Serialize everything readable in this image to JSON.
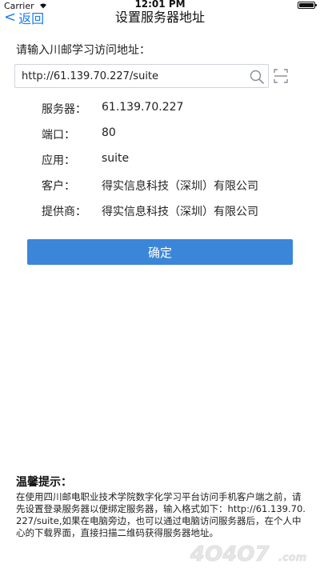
{
  "status_bar": {
    "carrier": "Carrier",
    "time": "12:01 PM"
  },
  "nav": {
    "back_label": "返回",
    "title": "设置服务器地址"
  },
  "form": {
    "prompt": "请输入川邮学习访问地址：",
    "url_value": "http://61.139.70.227/suite"
  },
  "info": [
    {
      "label": "服务器：",
      "value": "61.139.70.227"
    },
    {
      "label": "端口：",
      "value": "80"
    },
    {
      "label": "应用：",
      "value": "suite"
    },
    {
      "label": "客户：",
      "value": "得实信息科技（深圳）有限公司"
    },
    {
      "label": "提供商：",
      "value": "得实信息科技（深圳）有限公司"
    }
  ],
  "confirm_label": "确定",
  "tips": {
    "title": "温馨提示：",
    "body": "在使用四川邮电职业技术学院数字化学习平台访问手机客户端之前，请先设置登录服务器以便绑定服务器，输入格式如下：http://61.139.70.227/suite,如果在电脑旁边，也可以通过电脑访问服务器后，在个人中心的下载界面，直接扫描二维码获得服务器地址。"
  },
  "watermark": {
    "text": "4O4O7.com"
  },
  "colors": {
    "accent": "#1a7ef0",
    "button": "#3b86d8",
    "border": "#cfd4da"
  },
  "icons": {
    "search": "search-icon",
    "scan": "scan-icon",
    "back": "chevron-left-icon"
  }
}
